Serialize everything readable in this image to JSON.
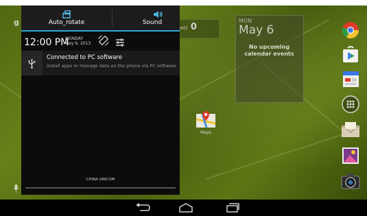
{
  "quick_settings": {
    "auto_rotate_label": "Auto_rotate",
    "sound_label": "Sound"
  },
  "status": {
    "time": "12:00 PM",
    "day": "MONDAY",
    "date": "May 6, 2013"
  },
  "notification": {
    "title": "Connected to PC software",
    "subtitle": "Install apps or manage data on the phone via PC software",
    "icon": "usb-icon"
  },
  "carrier": "CHINA UNICOM",
  "calendar_widget": {
    "month_day": "MON",
    "date": "May 6",
    "empty_text": "No upcoming calendar events"
  },
  "email_widget": {
    "label_fragment": "unt)",
    "count": "0"
  },
  "maps_label": "Maps",
  "dock_icons": [
    "chrome-icon",
    "play-store-icon",
    "calendar-icon",
    "apps-grid-icon",
    "email-icon",
    "gallery-icon",
    "camera-icon"
  ],
  "nav": {
    "back": "back-icon",
    "home": "home-icon",
    "recents": "recents-icon"
  },
  "colors": {
    "accent": "#2fa8da",
    "shade_bg": "#0c0c0c",
    "wallpaper": "#7ea11c"
  }
}
